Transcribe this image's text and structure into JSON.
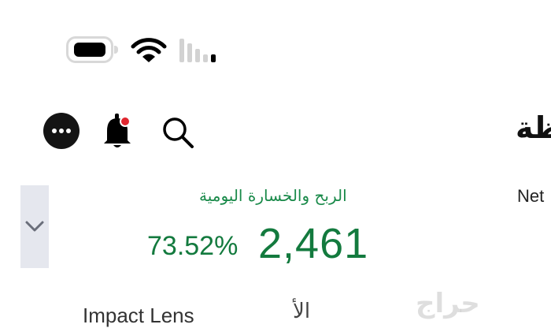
{
  "status_bar": {
    "battery_icon": "battery-full-icon",
    "wifi_icon": "wifi-icon",
    "signal_icon": "cellular-signal-icon"
  },
  "header": {
    "title_fragment": "ظة",
    "more_icon": "more-options-icon",
    "bell_icon": "notification-bell-icon",
    "bell_badge_color": "#e0262f",
    "search_icon": "search-icon"
  },
  "summary": {
    "collapse_icon": "chevron-down-icon",
    "daily_pl_label": "الربح والخسارة اليومية",
    "daily_pl_value": "2,461",
    "daily_pl_percent": "73.52%",
    "net_label_fragment": "Net",
    "accent_color": "#137a3e"
  },
  "tabs": {
    "impact_lens": "Impact Lens",
    "arabic_tab_fragment": "الأ"
  },
  "watermark": "حراج"
}
